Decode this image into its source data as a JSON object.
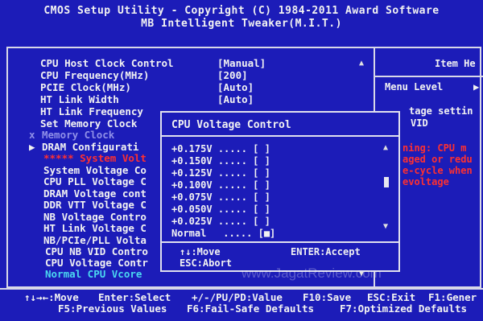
{
  "header": {
    "line1": "CMOS Setup Utility - Copyright (C) 1984-2011 Award Software",
    "line2": "MB Intelligent Tweaker(M.I.T.)"
  },
  "menu": [
    {
      "label": "CPU Host Clock Control",
      "value": "[Manual]"
    },
    {
      "label": "CPU Frequency(MHz)",
      "value": "[200]"
    },
    {
      "label": "PCIE Clock(MHz)",
      "value": "[Auto]"
    },
    {
      "label": "HT Link Width",
      "value": "[Auto]"
    },
    {
      "label": "HT Link Frequency",
      "value": ""
    },
    {
      "label": "Set Memory Clock",
      "value": ""
    },
    {
      "label": "Memory Clock",
      "marker": "x"
    },
    {
      "label": "DRAM Configurati",
      "marker": "▶"
    },
    {
      "label": "***** System Volt"
    },
    {
      "label": "System Voltage Co"
    },
    {
      "label": "CPU PLL Voltage C"
    },
    {
      "label": "DRAM Voltage cont"
    },
    {
      "label": "DDR VTT Voltage C"
    },
    {
      "label": "NB Voltage Contro"
    },
    {
      "label": "HT Link Voltage C"
    },
    {
      "label": "NB/PCIe/PLL Volta"
    },
    {
      "label": "CPU NB VID Contro"
    },
    {
      "label": "CPU Voltage Contr"
    },
    {
      "label": "Normal CPU Vcore"
    }
  ],
  "help": {
    "title": "Item He",
    "menu_level_label": "Menu Level",
    "menu_level_arrow": "▶",
    "line1": "tage settin",
    "line2": "VID",
    "warn1": "ning: CPU m",
    "warn2": "aged or redu",
    "warn3": "e-cycle when",
    "warn4": "evoltage"
  },
  "popup": {
    "title": "CPU Voltage Control",
    "options": [
      {
        "value": "+0.175V",
        "dots": ".....",
        "radio": "[ ]"
      },
      {
        "value": "+0.150V",
        "dots": ".....",
        "radio": "[ ]"
      },
      {
        "value": "+0.125V",
        "dots": ".....",
        "radio": "[ ]"
      },
      {
        "value": "+0.100V",
        "dots": ".....",
        "radio": "[ ]"
      },
      {
        "value": "+0.075V",
        "dots": ".....",
        "radio": "[ ]"
      },
      {
        "value": "+0.050V",
        "dots": ".....",
        "radio": "[ ]"
      },
      {
        "value": "+0.025V",
        "dots": ".....",
        "radio": "[ ]"
      },
      {
        "value": "Normal",
        "dots": ".....",
        "radio": "[■]"
      }
    ],
    "move": "↑↓:Move",
    "enter": "ENTER:Accept",
    "abort": "ESC:Abort"
  },
  "watermark": "www.JagatReview.com",
  "footer": {
    "row1": [
      "↑↓→←:Move",
      "Enter:Select",
      "+/-/PU/PD:Value",
      "F10:Save",
      "ESC:Exit",
      "F1:Gener"
    ],
    "row2": [
      "F5:Previous Values",
      "F6:Fail-Safe Defaults",
      "F7:Optimized Defaults"
    ]
  },
  "colors": {
    "background": "#1c1cb8",
    "warning": "#ff3030",
    "highlight": "#4ad8f0"
  }
}
